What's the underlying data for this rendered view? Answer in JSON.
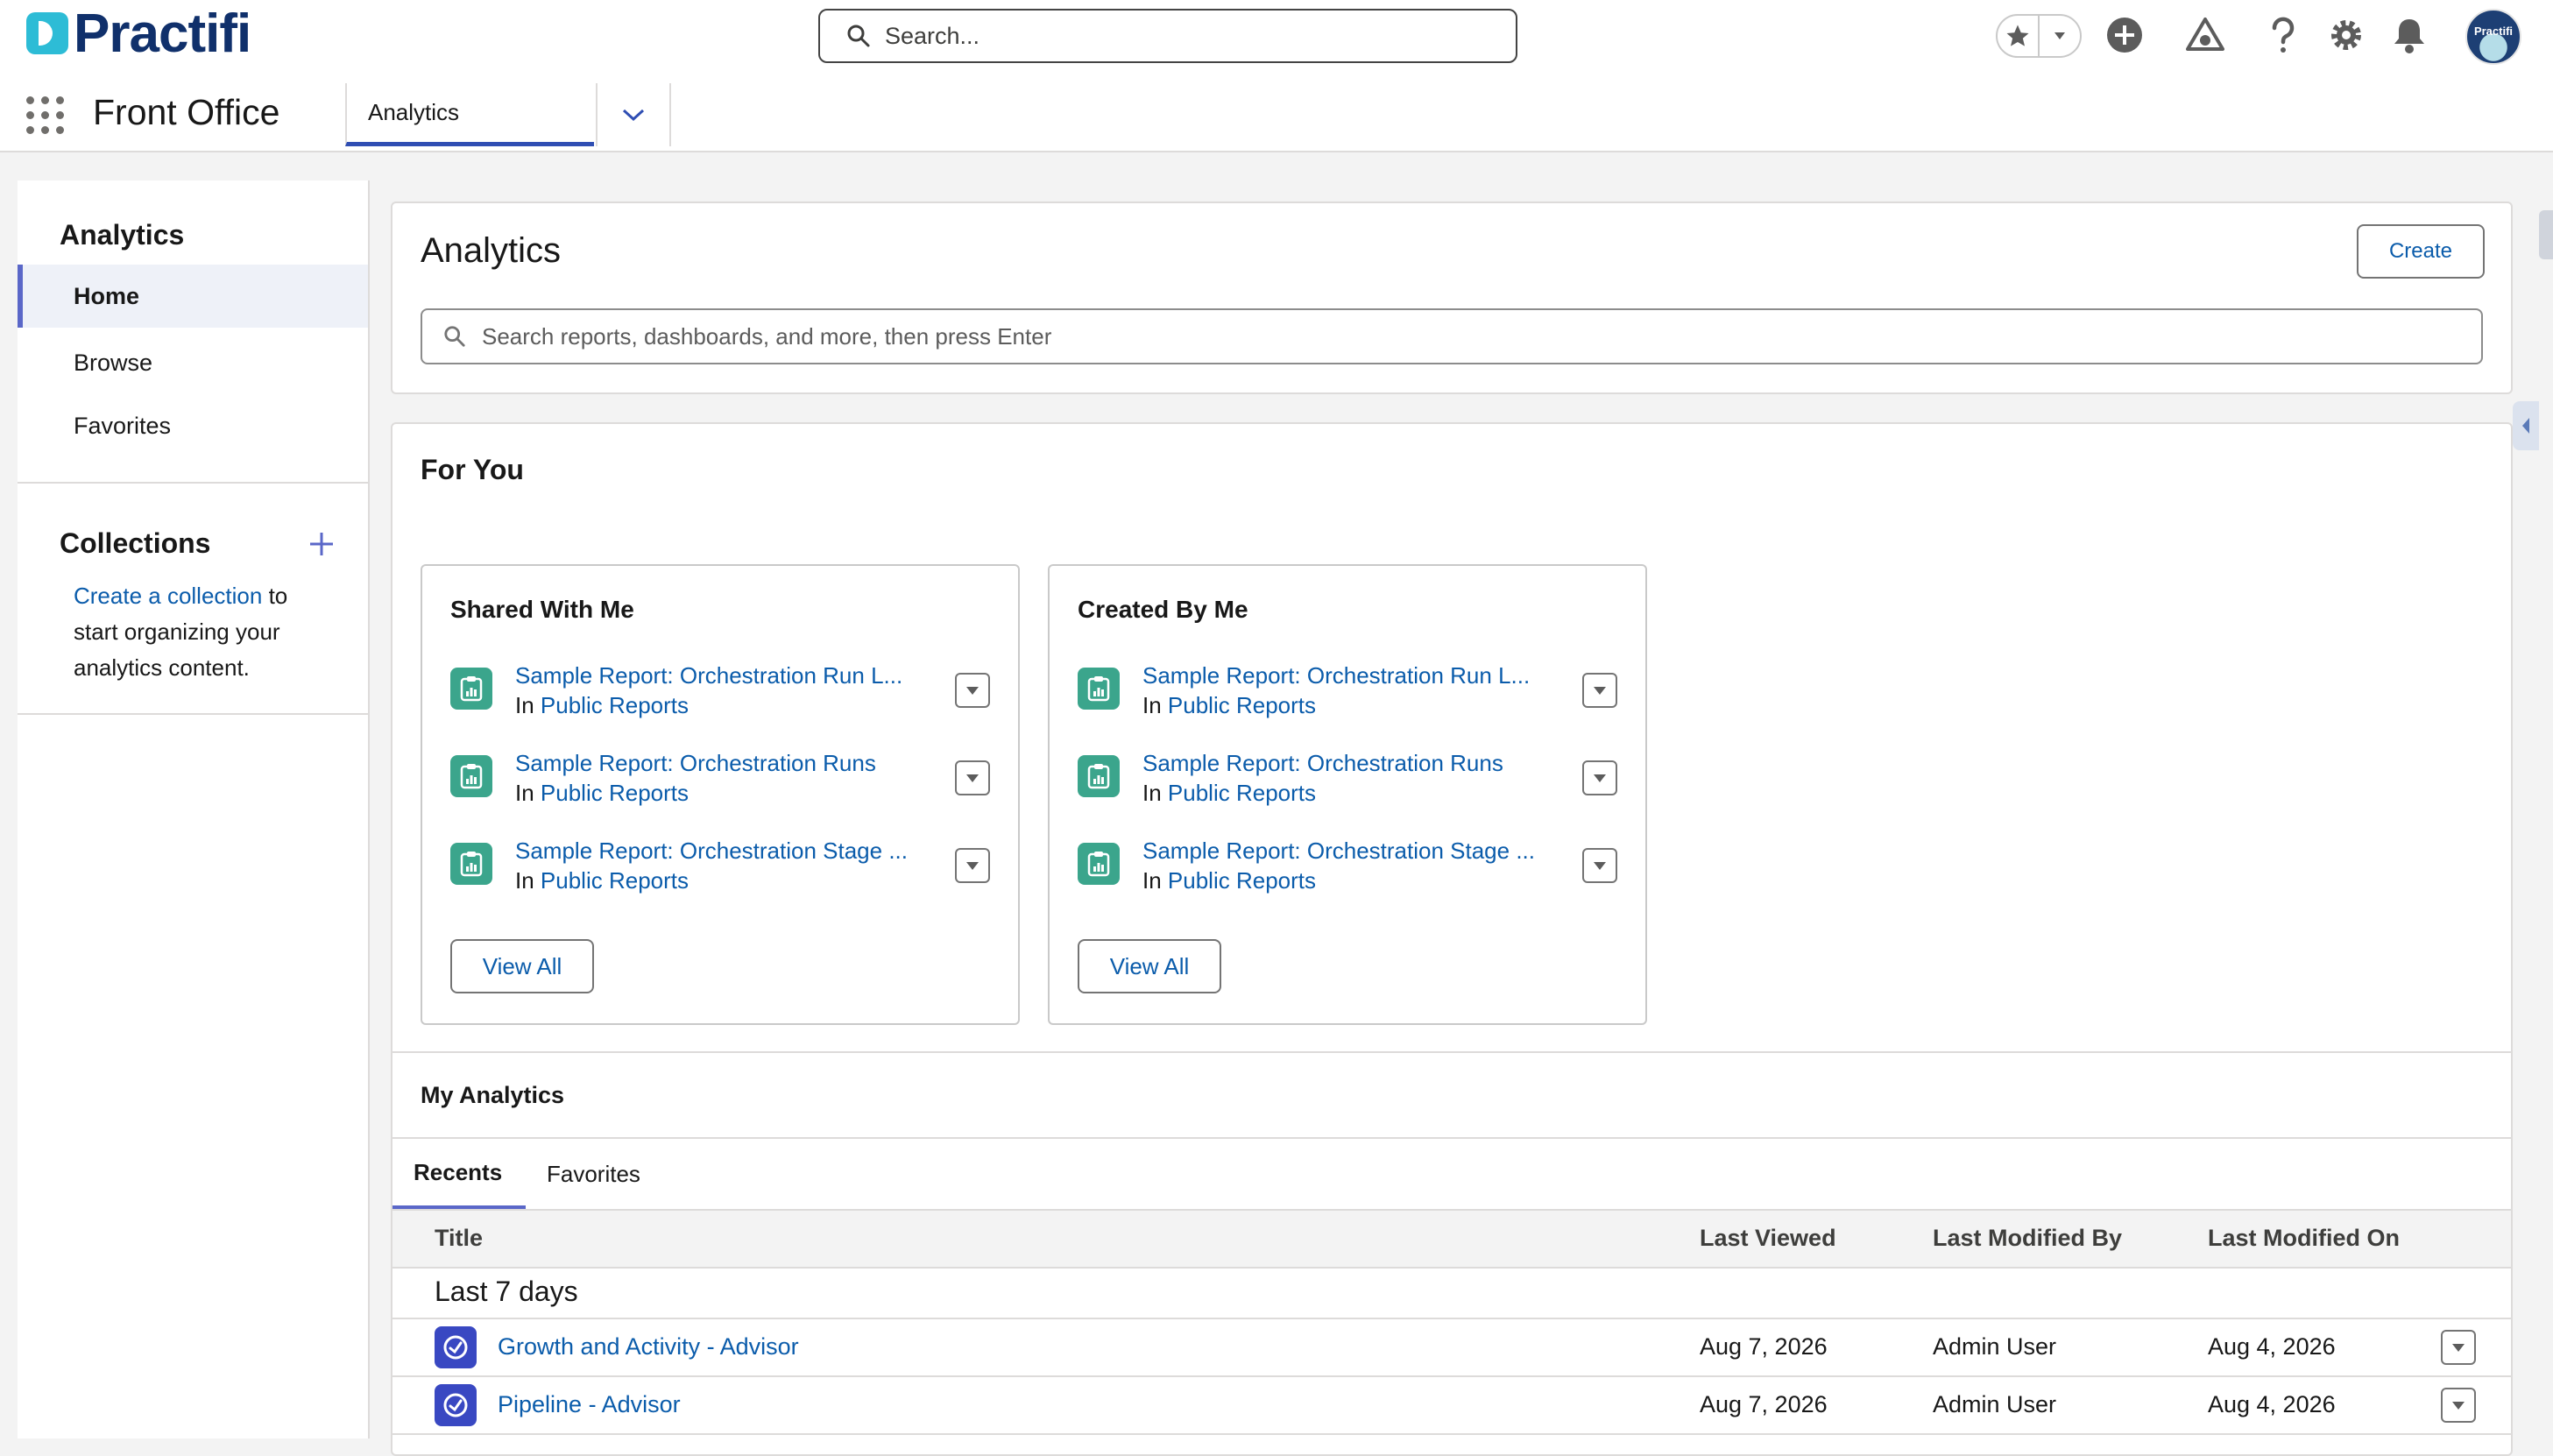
{
  "header": {
    "logo_text": "Practifi",
    "search_placeholder": "Search...",
    "avatar_text": "Practifi"
  },
  "nav": {
    "app_name": "Front Office",
    "active_tab": "Analytics"
  },
  "sidebar": {
    "title": "Analytics",
    "items": [
      {
        "label": "Home",
        "active": true
      },
      {
        "label": "Browse",
        "active": false
      },
      {
        "label": "Favorites",
        "active": false
      }
    ],
    "collections_title": "Collections",
    "collections_link": "Create a collection",
    "collections_text_1": " to",
    "collections_text_2": "start organizing your",
    "collections_text_3": "analytics content."
  },
  "main": {
    "title": "Analytics",
    "create_label": "Create",
    "search_placeholder": "Search reports, dashboards, and more, then press Enter",
    "for_you_title": "For You",
    "shared": {
      "title": "Shared With Me",
      "items": [
        {
          "name": "Sample Report: Orchestration Run L...",
          "prefix": "In",
          "folder": "Public Reports"
        },
        {
          "name": "Sample Report: Orchestration Runs",
          "prefix": "In",
          "folder": "Public Reports"
        },
        {
          "name": "Sample Report: Orchestration Stage ...",
          "prefix": "In",
          "folder": "Public Reports"
        }
      ],
      "view_all": "View All"
    },
    "created": {
      "title": "Created By Me",
      "items": [
        {
          "name": "Sample Report: Orchestration Run L...",
          "prefix": "In",
          "folder": "Public Reports"
        },
        {
          "name": "Sample Report: Orchestration Runs",
          "prefix": "In",
          "folder": "Public Reports"
        },
        {
          "name": "Sample Report: Orchestration Stage ...",
          "prefix": "In",
          "folder": "Public Reports"
        }
      ],
      "view_all": "View All"
    },
    "my_analytics_title": "My Analytics",
    "tabs": [
      {
        "label": "Recents",
        "active": true
      },
      {
        "label": "Favorites",
        "active": false
      }
    ],
    "table": {
      "columns": [
        "Title",
        "Last Viewed",
        "Last Modified By",
        "Last Modified On"
      ],
      "group_label": "Last 7 days",
      "rows": [
        {
          "title": "Growth and Activity - Advisor",
          "last_viewed": "Aug 7, 2026",
          "modified_by": "Admin User",
          "modified_on": "Aug 4, 2026"
        },
        {
          "title": "Pipeline - Advisor",
          "last_viewed": "Aug 7, 2026",
          "modified_by": "Admin User",
          "modified_on": "Aug 4, 2026"
        }
      ]
    }
  },
  "colors": {
    "link": "#0b5cab",
    "report_icon": "#3ba58c",
    "dashboard_icon": "#3948c2",
    "active_accent": "#5a67c8",
    "brand_navy": "#10306b",
    "brand_cyan": "#2dbcd6"
  }
}
